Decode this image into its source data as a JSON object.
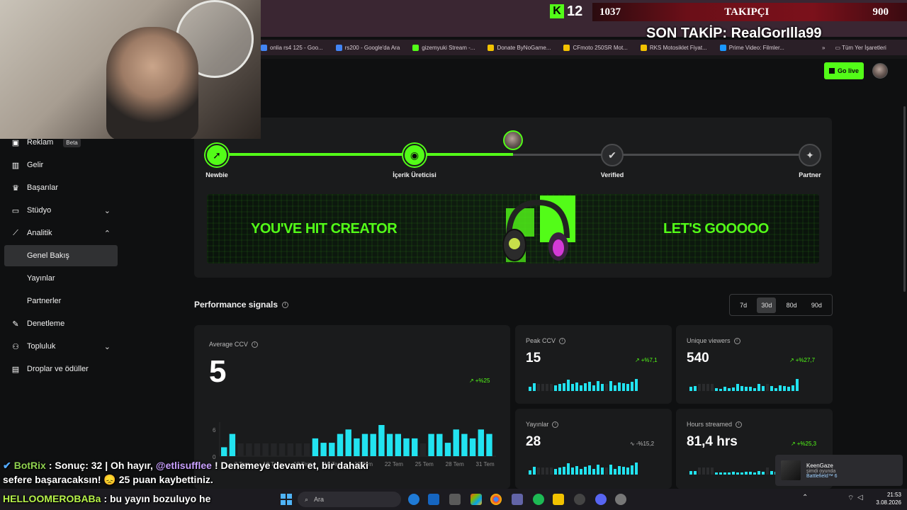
{
  "overlay": {
    "kick_count": "12",
    "follower_current": "1037",
    "follower_label": "TAKIPÇI",
    "follower_goal": "900",
    "last_follow": "SON TAKİP: RealGorIlla99"
  },
  "bookmarks": [
    {
      "label": "onlia rs4 125 - Goo...",
      "color": "#4285f4"
    },
    {
      "label": "rs200 - Google'da Ara",
      "color": "#4285f4"
    },
    {
      "label": "gizemyuki Stream -...",
      "color": "#53fc18"
    },
    {
      "label": "Donate ByNoGame...",
      "color": "#f2c200"
    },
    {
      "label": "CFmoto 250SR Mot...",
      "color": "#f2c200"
    },
    {
      "label": "RKS Motosiklet Fiyat...",
      "color": "#f2c200"
    },
    {
      "label": "Prime Video: Filmler...",
      "color": "#1a98ff"
    }
  ],
  "bookmarks_right": {
    "all_bookmarks": "Tüm Yer İşaretleri"
  },
  "header": {
    "go_live": "Go live"
  },
  "sidebar": {
    "items": [
      {
        "label": "Reklam",
        "badge": "Beta",
        "icon": "megaphone-icon"
      },
      {
        "label": "Gelir",
        "icon": "chart-icon"
      },
      {
        "label": "Başarılar",
        "icon": "trophy-icon"
      },
      {
        "label": "Stüdyo",
        "icon": "studio-icon"
      },
      {
        "label": "Analitik",
        "icon": "analytics-icon"
      },
      {
        "label": "Genel Bakış"
      },
      {
        "label": "Yayınlar"
      },
      {
        "label": "Partnerler"
      },
      {
        "label": "Denetleme",
        "icon": "wrench-icon"
      },
      {
        "label": "Topluluk",
        "icon": "community-icon"
      },
      {
        "label": "Droplar ve ödüller",
        "icon": "gift-icon"
      }
    ]
  },
  "milestones": {
    "steps": [
      "Newbie",
      "İçerik Üreticisi",
      "Verified",
      "Partner"
    ],
    "progress": 0.5,
    "banner_left": "YOU'VE HIT CREATOR",
    "banner_right": "LET'S GOOOOO"
  },
  "performance": {
    "title": "Performance signals",
    "ranges": [
      "7d",
      "30d",
      "80d",
      "90d"
    ],
    "active_range": "30d",
    "average_ccv": {
      "title": "Average CCV",
      "value": "5",
      "change": "+%25"
    },
    "cards": [
      {
        "title": "Peak CCV",
        "value": "15",
        "change": "+%7,1",
        "direction": "up"
      },
      {
        "title": "Unique viewers",
        "value": "540",
        "change": "+%27,7",
        "direction": "up"
      },
      {
        "title": "Yayınlar",
        "value": "28",
        "change": "-%15,2",
        "direction": "flat"
      },
      {
        "title": "Hours streamed",
        "value": "81,4 hrs",
        "change": "+%25,3",
        "direction": "up"
      }
    ]
  },
  "chart_data": {
    "type": "bar",
    "title": "Average CCV",
    "y_ticks": [
      "6",
      "0"
    ],
    "x_tick_labels": [
      "7 Tem",
      "10 Tem",
      "13 Tem",
      "16 Tem",
      "19 Tem",
      "22 Tem",
      "25 Tem",
      "28 Tem",
      "31 Tem"
    ],
    "values": [
      2,
      5,
      0,
      0,
      0,
      0,
      0,
      0,
      0,
      0,
      0,
      4,
      3,
      3,
      5,
      6,
      4,
      5,
      5,
      7,
      5,
      5,
      4,
      4,
      0,
      5,
      5,
      3,
      6,
      5,
      4,
      6,
      5
    ],
    "ylim": [
      0,
      7
    ]
  },
  "chat": {
    "line1_user": "BotRix",
    "line1_text_a": ": Sonuç: 32 | Oh hayır,",
    "line1_mention": "@etlisufflee",
    "line1_text_b": "! Denemeye devam et, bir dahaki",
    "line1_cont": "sefere başaracaksın! 😞 25 puan kaybettiniz.",
    "line2_user": "HELLOOMEROBABa",
    "line2_text": ": bu yayın bozuluyo he"
  },
  "toast": {
    "name": "KeenGaze",
    "status": "şimdi oyunda",
    "game": "Battlefield™ 6"
  },
  "taskbar": {
    "search": "Ara",
    "time": "21:53",
    "date": "3.08.2026"
  }
}
